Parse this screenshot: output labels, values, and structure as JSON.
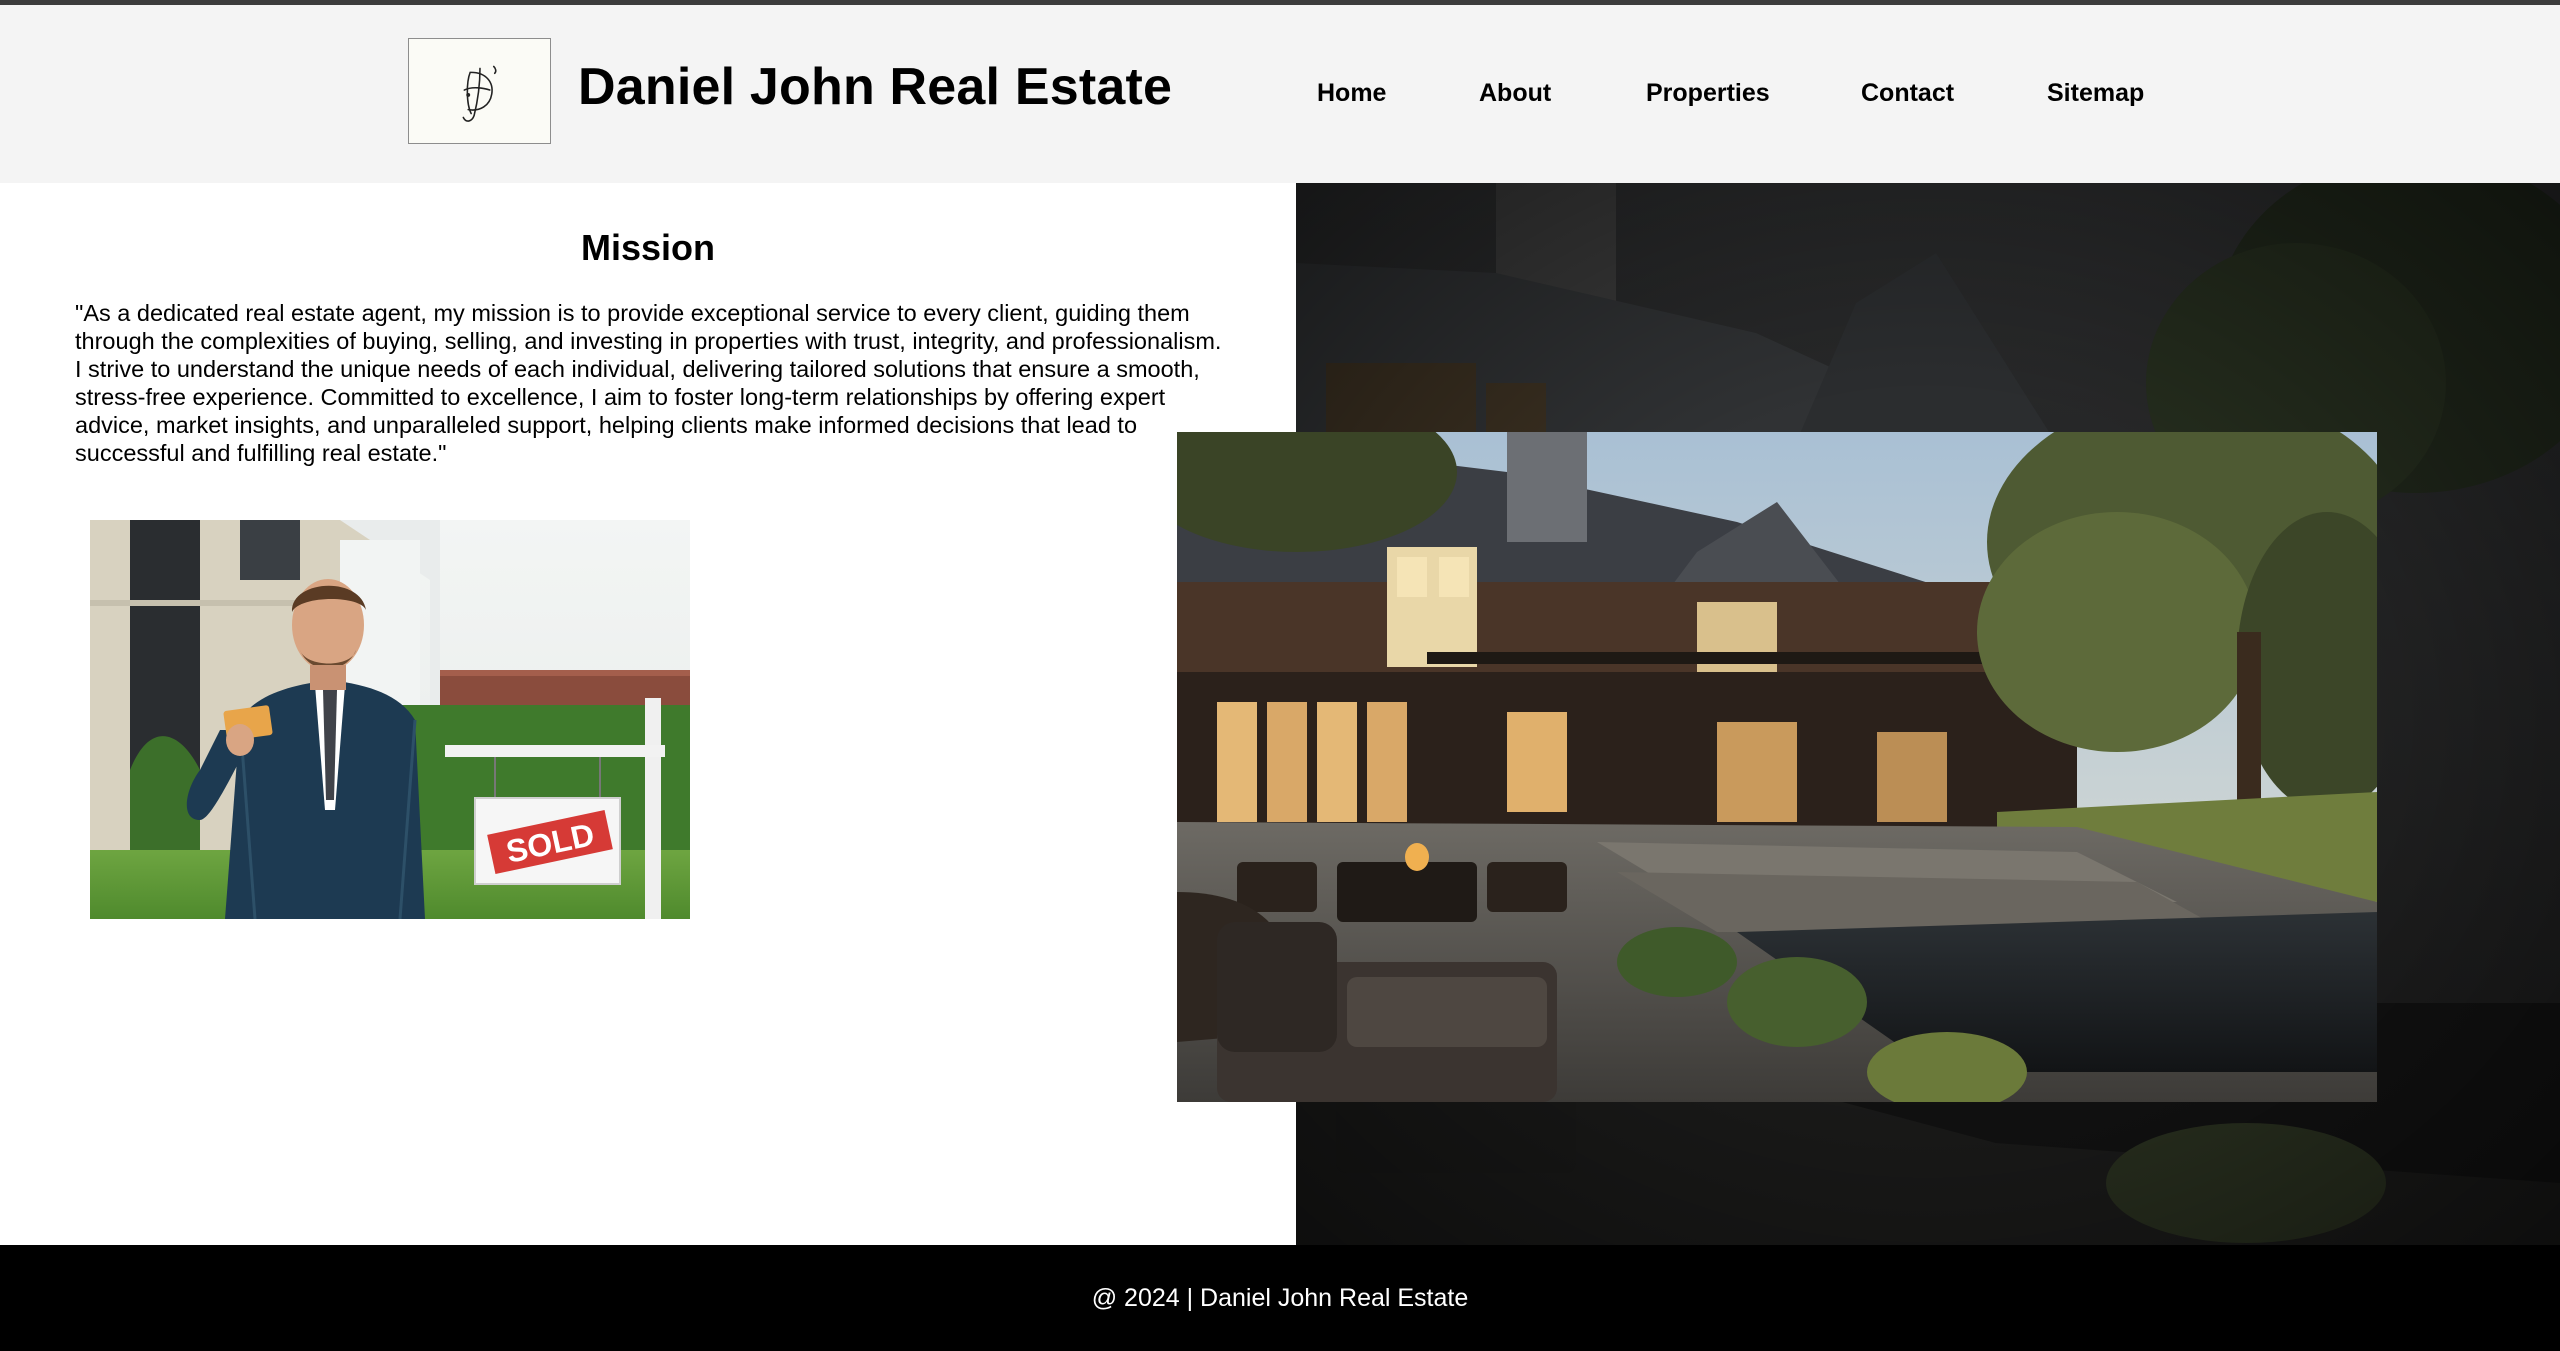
{
  "header": {
    "logo_alt": "DJ monogram",
    "site_title": "Daniel John Real Estate"
  },
  "nav": {
    "items": [
      {
        "label": "Home"
      },
      {
        "label": "About"
      },
      {
        "label": "Properties"
      },
      {
        "label": "Contact"
      },
      {
        "label": "Sitemap"
      }
    ]
  },
  "mission": {
    "title": "Mission",
    "text": "\"As a dedicated real estate agent, my mission is to provide exceptional service to every client, guiding them through the complexities of buying, selling, and investing in properties with trust, integrity, and professionalism. I strive to understand the unique needs of each individual, delivering tailored solutions that ensure a smooth, stress-free experience. Committed to excellence, I aim to foster long-term relationships by offering expert advice, market insights, and unparalleled support, helping clients make informed decisions that lead to successful and fulfilling real estate.\""
  },
  "photos": {
    "agent_sign": "SOLD"
  },
  "footer": {
    "text": "@ 2024 | Daniel John Real Estate"
  },
  "colors": {
    "header_bg": "#f4f4f4",
    "footer_bg": "#000000",
    "sold_red": "#d63a36"
  }
}
